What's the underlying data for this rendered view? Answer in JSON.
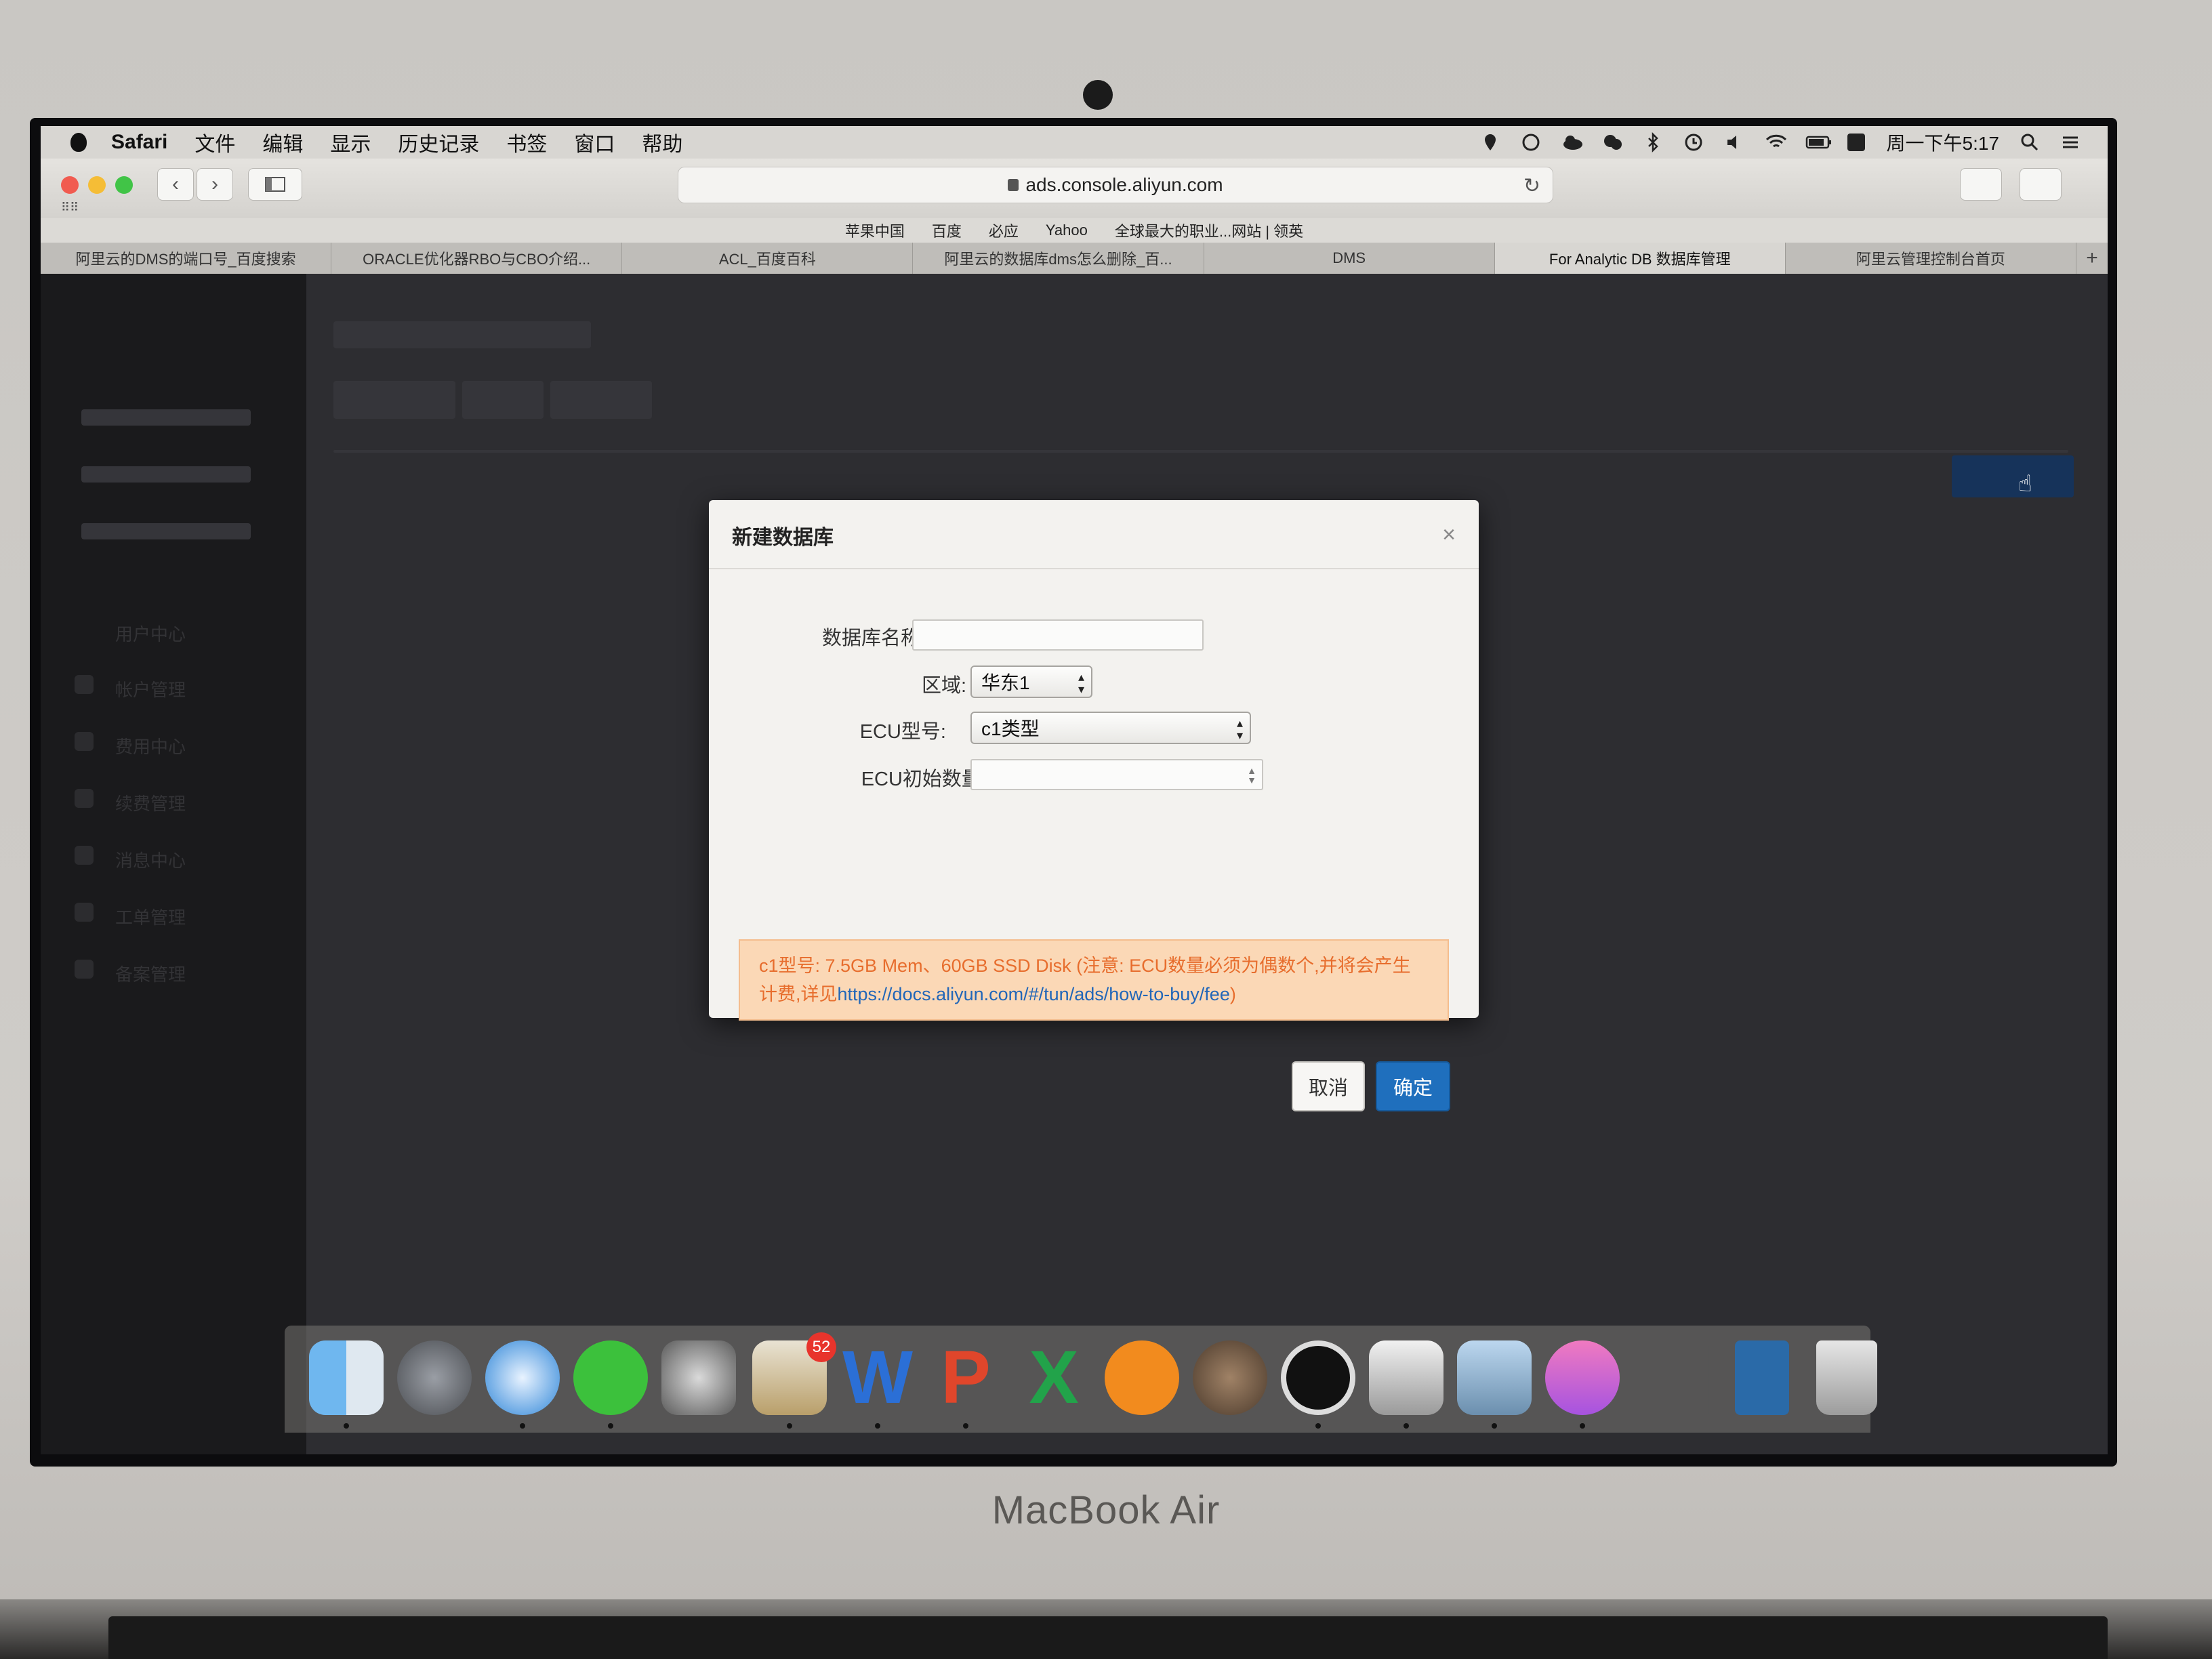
{
  "menubar": {
    "items": [
      "Safari",
      "文件",
      "编辑",
      "显示",
      "历史记录",
      "书签",
      "窗口",
      "帮助"
    ],
    "clock": "周一下午5:17"
  },
  "browser": {
    "url": "ads.console.aliyun.com",
    "favorites": [
      "苹果中国",
      "百度",
      "必应",
      "Yahoo",
      "全球最大的职业...网站 | 领英"
    ],
    "tabs": [
      "阿里云的DMS的端口号_百度搜索",
      "ORACLE优化器RBO与CBO介绍...",
      "ACL_百度百科",
      "阿里云的数据库dms怎么删除_百...",
      "DMS",
      "For Analytic DB 数据库管理",
      "阿里云管理控制台首页"
    ],
    "active_tab": 5,
    "new_tab": "+"
  },
  "sidebar": {
    "items": [
      "用户中心",
      "帐户管理",
      "费用中心",
      "续费管理",
      "消息中心",
      "工单管理",
      "备案管理"
    ]
  },
  "modal": {
    "title": "新建数据库",
    "close": "×",
    "fields": {
      "db_name_label": "数据库名称:",
      "db_name_value": "",
      "region_label": "区域:",
      "region_value": "华东1",
      "ecu_type_label": "ECU型号:",
      "ecu_type_value": "c1类型",
      "ecu_count_label": "ECU初始数量:",
      "ecu_count_value": ""
    },
    "notice_text": "c1型号: 7.5GB Mem、60GB SSD Disk (注意: ECU数量必须为偶数个,并将会产生计费,详见",
    "notice_link": "https://docs.aliyun.com/#/tun/ads/how-to-buy/fee",
    "notice_tail": ")",
    "cancel_label": "取消",
    "ok_label": "确定"
  },
  "dock": {
    "badge": "52",
    "apps": [
      "finder-icon",
      "launchpad-icon",
      "safari-icon",
      "wechat-icon",
      "system-preferences-icon",
      "mail-icon",
      "word-icon",
      "powerpoint-icon",
      "excel-icon",
      "ibooks-icon",
      "scroll-icon",
      "sync-icon",
      "mission-control-icon",
      "photos-icon",
      "itunes-icon",
      "document-icon",
      "trash-icon"
    ]
  },
  "hardware": {
    "brand": "MacBook Air"
  }
}
